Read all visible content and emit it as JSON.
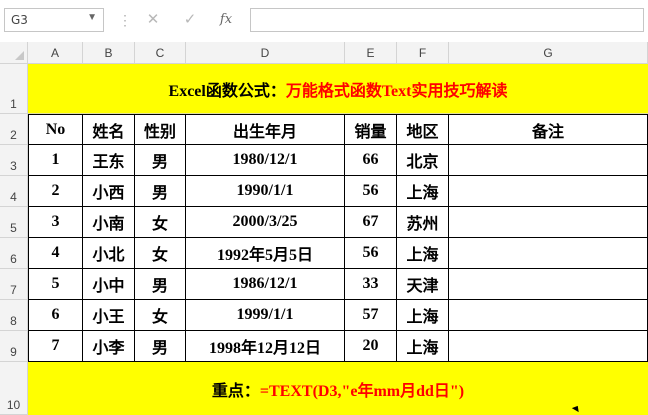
{
  "formula_bar": {
    "name_box": "G3",
    "fx_label": "fx",
    "formula": ""
  },
  "columns": [
    "A",
    "B",
    "C",
    "D",
    "E",
    "F",
    "G"
  ],
  "rows": [
    "1",
    "2",
    "3",
    "4",
    "5",
    "6",
    "7",
    "8",
    "9",
    "10"
  ],
  "sheet": {
    "title_black": "Excel函数公式：",
    "title_red": "万能格式函数Text实用技巧解读",
    "headers": [
      "No",
      "姓名",
      "性别",
      "出生年月",
      "销量",
      "地区",
      "备注"
    ],
    "data": [
      [
        "1",
        "王东",
        "男",
        "1980/12/1",
        "66",
        "北京",
        ""
      ],
      [
        "2",
        "小西",
        "男",
        "1990/1/1",
        "56",
        "上海",
        ""
      ],
      [
        "3",
        "小南",
        "女",
        "2000/3/25",
        "67",
        "苏州",
        ""
      ],
      [
        "4",
        "小北",
        "女",
        "1992年5月5日",
        "56",
        "上海",
        ""
      ],
      [
        "5",
        "小中",
        "男",
        "1986/12/1",
        "33",
        "天津",
        ""
      ],
      [
        "6",
        "小王",
        "女",
        "1999/1/1",
        "57",
        "上海",
        ""
      ],
      [
        "7",
        "小李",
        "男",
        "1998年12月12日",
        "20",
        "上海",
        ""
      ]
    ],
    "note_label": "重点：",
    "note_formula": "=TEXT(D3,\"e年mm月dd日\")"
  },
  "colors": {
    "highlight": "#ffff00",
    "accent_red": "#ff0000"
  }
}
